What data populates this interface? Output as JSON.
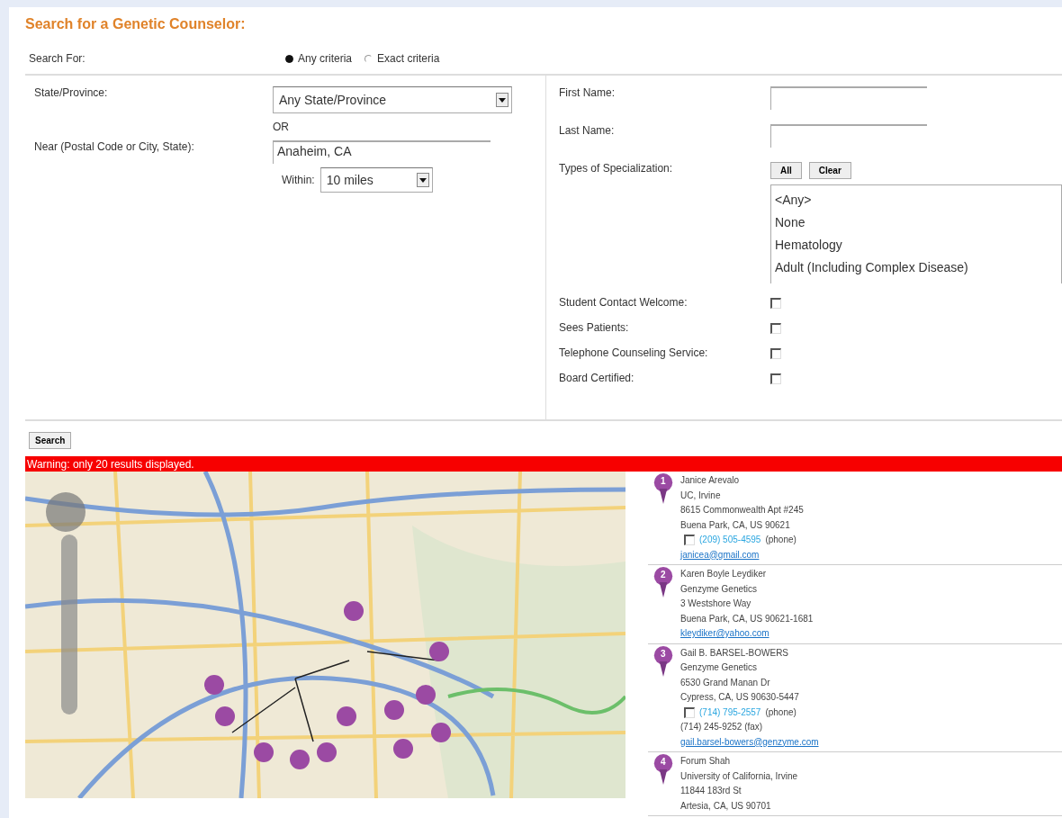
{
  "title": "Search for a Genetic Counselor:",
  "search_for": {
    "label": "Search For:",
    "options": [
      {
        "label": "Any criteria",
        "selected": true
      },
      {
        "label": "Exact criteria",
        "selected": false
      }
    ]
  },
  "location": {
    "state_label": "State/Province:",
    "state_value": "Any State/Province",
    "or_text": "OR",
    "near_label": "Near (Postal Code or City, State):",
    "near_value": "Anaheim, CA",
    "within_label": "Within:",
    "within_value": "10 miles"
  },
  "names": [
    {
      "label": "First Name:"
    },
    {
      "label": "Last Name:"
    }
  ],
  "specialization": {
    "label": "Types of Specialization:",
    "buttons": [
      "All",
      "Clear"
    ],
    "options": [
      "<Any>",
      "None",
      "Hematology",
      "Adult (Including Complex Disease)"
    ]
  },
  "filters": [
    {
      "label": "Student Contact Welcome:",
      "checked": false
    },
    {
      "label": "Sees Patients:",
      "checked": false
    },
    {
      "label": "Telephone Counseling Service:",
      "checked": false
    },
    {
      "label": "Board Certified:",
      "checked": false
    }
  ],
  "search_button": "Search",
  "warning": "Warning: only 20 results displayed.",
  "results": [
    {
      "number": "1",
      "lines": [
        "Janice Arevalo",
        "UC, Irvine",
        "8615 Commonwealth Apt #245",
        "Buena Park, CA, US 90621"
      ],
      "phone": {
        "number": "(209) 505-4595",
        "type": "(phone)",
        "checked": false
      },
      "email": "janicea@gmail.com"
    },
    {
      "number": "2",
      "lines": [
        "Karen Boyle Leydiker",
        "Genzyme Genetics",
        "3 Westshore Way",
        "Buena Park, CA, US 90621-1681"
      ],
      "email": "kleydiker@yahoo.com"
    },
    {
      "number": "3",
      "lines": [
        "Gail B. BARSEL-BOWERS",
        "Genzyme Genetics",
        "6530 Grand Manan Dr",
        "Cypress, CA, US 90630-5447"
      ],
      "phone": {
        "number": "(714) 795-2557",
        "type": "(phone)",
        "checked": false
      },
      "fax": "(714) 245-9252 (fax)",
      "email": "gail.barsel-bowers@genzyme.com"
    },
    {
      "number": "4",
      "lines": [
        "Forum Shah",
        "University of California, Irvine",
        "11844 183rd St",
        "Artesia, CA, US 90701"
      ]
    }
  ]
}
